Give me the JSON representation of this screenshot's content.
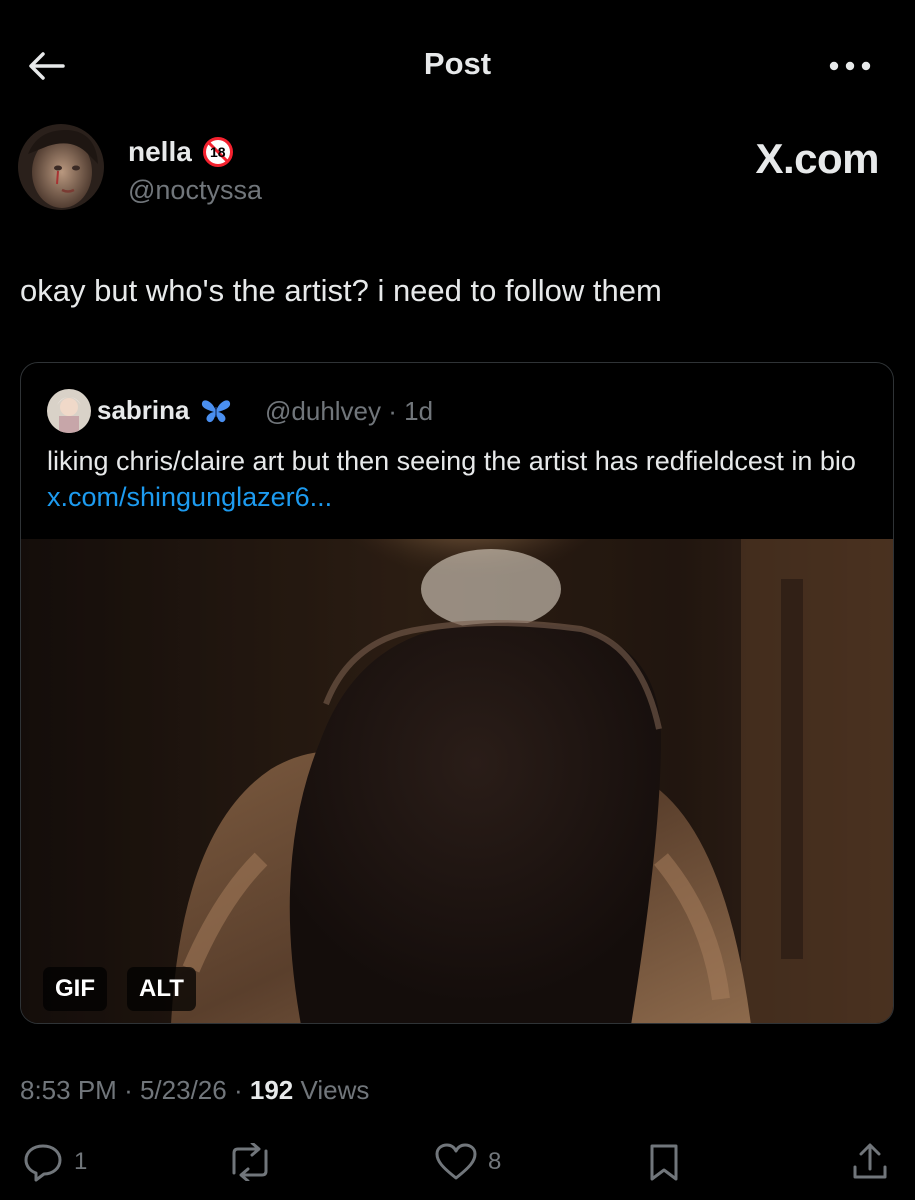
{
  "header": {
    "title": "Post"
  },
  "author": {
    "name": "nella",
    "handle": "@noctyssa",
    "badge": "18"
  },
  "watermark": "X.com",
  "post": {
    "text": "okay but who's the artist? i need to follow them"
  },
  "quote": {
    "name": "sabrina",
    "handle": "@duhlvey",
    "time": "· 1d",
    "text": "liking chris/claire art but then seeing the artist has redfieldcest in bio ",
    "link": "x.com/shingunglazer6...",
    "badges": {
      "gif": "GIF",
      "alt": "ALT"
    }
  },
  "meta": {
    "time": "8:53 PM",
    "date": "5/23/26",
    "views_count": "192",
    "views_label": "Views",
    "sep": "·"
  },
  "actions": {
    "reply_count": "1",
    "like_count": "8"
  },
  "colors": {
    "background": "#000000",
    "text": "#e7e9ea",
    "muted": "#71767b",
    "link": "#1d9bf0",
    "badge_red": "#f4212e"
  }
}
